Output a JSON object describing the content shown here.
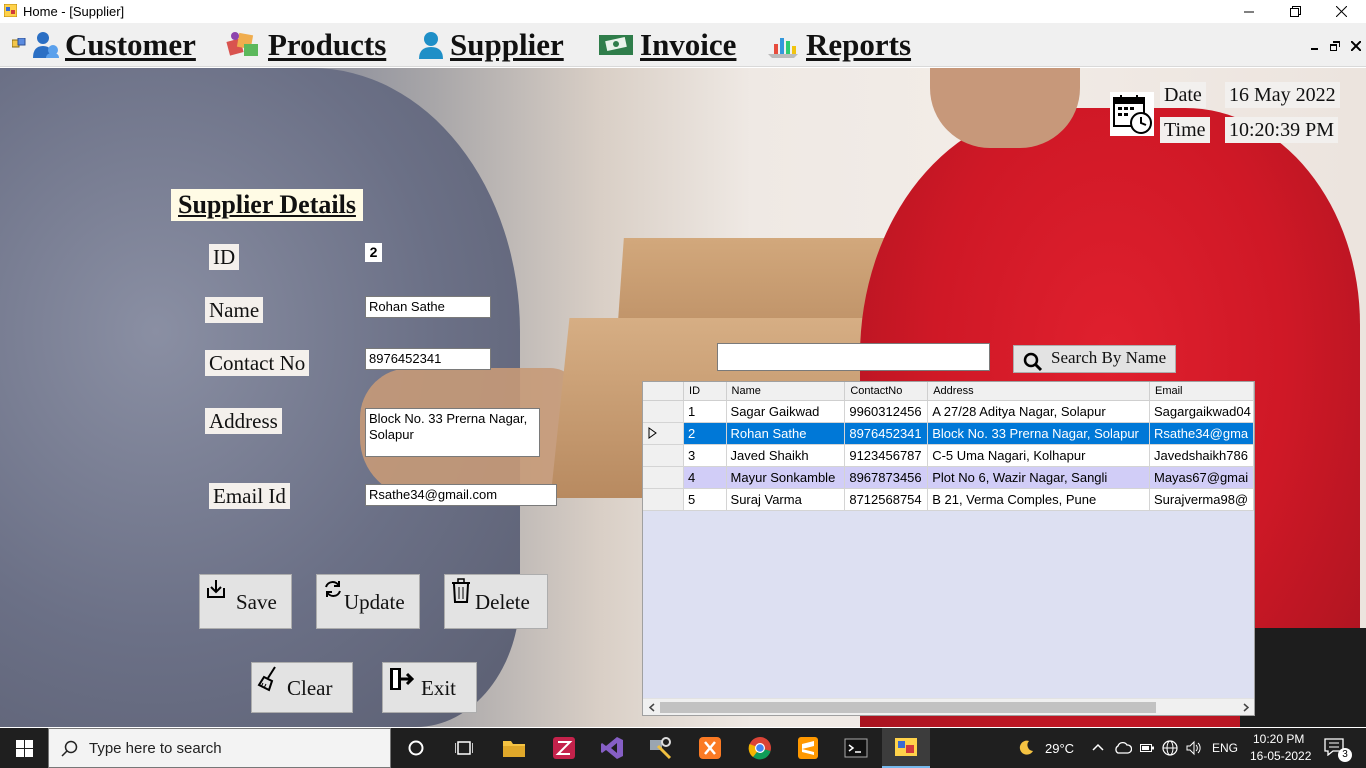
{
  "window": {
    "title": "Home - [Supplier]"
  },
  "menu": {
    "items": [
      {
        "label": "Customer",
        "icon": "customer-icon"
      },
      {
        "label": "Products",
        "icon": "products-icon"
      },
      {
        "label": "Supplier",
        "icon": "supplier-icon"
      },
      {
        "label": "Invoice",
        "icon": "invoice-icon"
      },
      {
        "label": "Reports",
        "icon": "reports-icon"
      }
    ]
  },
  "datetime": {
    "date_label": "Date",
    "date_value": "16 May 2022",
    "time_label": "Time",
    "time_value": "10:20:39 PM"
  },
  "form": {
    "heading": "Supplier Details",
    "id_label": "ID",
    "id_value": "2",
    "name_label": "Name",
    "name_value": "Rohan Sathe",
    "contact_label": "Contact No",
    "contact_value": "8976452341",
    "address_label": "Address",
    "address_value": "Block No. 33 Prerna Nagar, Solapur",
    "email_label": "Email Id",
    "email_value": "Rsathe34@gmail.com"
  },
  "buttons": {
    "save": "Save",
    "update": "Update",
    "delete": "Delete",
    "clear": "Clear",
    "exit": "Exit"
  },
  "search": {
    "value": "",
    "button_label": "Search By Name"
  },
  "grid": {
    "columns": [
      "ID",
      "Name",
      "ContactNo",
      "Address",
      "Email"
    ],
    "rows": [
      [
        "1",
        "Sagar Gaikwad",
        "9960312456",
        "A 27/28 Aditya Nagar, Solapur",
        "Sagargaikwad04"
      ],
      [
        "2",
        "Rohan Sathe",
        "8976452341",
        "Block No. 33 Prerna Nagar, Solapur",
        "Rsathe34@gma"
      ],
      [
        "3",
        "Javed Shaikh",
        "9123456787",
        "C-5 Uma Nagari, Kolhapur",
        "Javedshaikh786"
      ],
      [
        "4",
        "Mayur Sonkamble",
        "8967873456",
        "Plot No 6, Wazir Nagar, Sangli",
        "Mayas67@gmai"
      ],
      [
        "5",
        "Suraj Varma",
        "8712568754",
        "B 21, Verma Comples, Pune",
        "Surajverma98@"
      ]
    ],
    "selected_row_index": 1,
    "alternate_row_index": 3
  },
  "taskbar": {
    "search_placeholder": "Type here to search",
    "weather": "29°C",
    "language": "ENG",
    "clock_time": "10:20 PM",
    "clock_date": "16-05-2022",
    "notification_count": "3"
  },
  "colors": {
    "selection": "#0078d7",
    "alt_row": "#d1cdf7",
    "grid_bg": "#dde0f2",
    "taskbar": "#1f1f1f"
  }
}
